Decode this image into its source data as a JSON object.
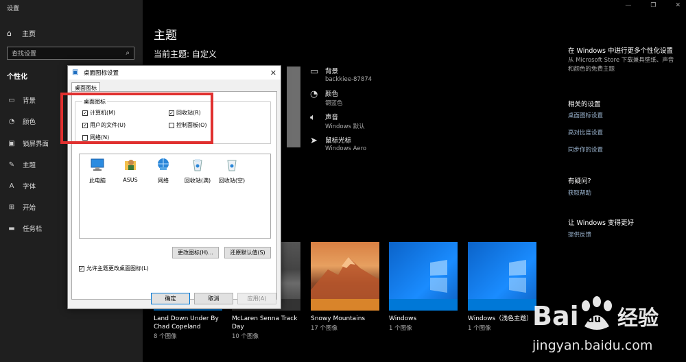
{
  "app": {
    "title": "设置"
  },
  "sidebar": {
    "home": "主页",
    "search_placeholder": "查找设置",
    "section": "个性化",
    "items": [
      {
        "label": "背景",
        "icon": "image-icon"
      },
      {
        "label": "颜色",
        "icon": "palette-icon"
      },
      {
        "label": "锁屏界面",
        "icon": "lockscreen-icon"
      },
      {
        "label": "主题",
        "icon": "brush-icon"
      },
      {
        "label": "字体",
        "icon": "font-icon"
      },
      {
        "label": "开始",
        "icon": "start-icon"
      },
      {
        "label": "任务栏",
        "icon": "taskbar-icon"
      }
    ]
  },
  "main": {
    "title": "主题",
    "current_theme": "当前主题: 自定义",
    "props": [
      {
        "title": "背景",
        "sub": "backkiee-87874",
        "icon": "image-icon"
      },
      {
        "title": "颜色",
        "sub": "钢蓝色",
        "icon": "palette-icon"
      },
      {
        "title": "声音",
        "sub": "Windows 默认",
        "icon": "speaker-icon"
      },
      {
        "title": "鼠标光标",
        "sub": "Windows Aero",
        "icon": "cursor-icon"
      }
    ],
    "themes": [
      {
        "name": "Land Down Under By Chad Copeland",
        "count": "8 个图像",
        "bar_color": "#1e2a4a"
      },
      {
        "name": "McLaren Senna Track Day",
        "count": "10 个图像",
        "bar_color": "#333333"
      },
      {
        "name": "Snowy Mountains",
        "count": "17 个图像",
        "bar_color": "#d9842a"
      },
      {
        "name": "Windows",
        "count": "1 个图像",
        "bar_color": "#0078d7"
      },
      {
        "name": "Windows（浅色主题）",
        "count": "1 个图像",
        "bar_color": "#0078d7"
      }
    ]
  },
  "right": {
    "more_title": "在 Windows 中进行更多个性化设置",
    "more_desc": "从 Microsoft Store 下载兼具壁纸、声音和颜色的免费主题",
    "related_title": "相关的设置",
    "related_links": [
      "桌面图标设置",
      "高对比度设置",
      "同步你的设置"
    ],
    "help_title": "有疑问?",
    "help_link": "获取帮助",
    "improve_title": "让 Windows 变得更好",
    "improve_link": "提供反馈"
  },
  "dialog": {
    "title": "桌面图标设置",
    "tab": "桌面图标",
    "group_label": "桌面图标",
    "checkboxes": [
      {
        "label": "计算机(M)",
        "checked": true
      },
      {
        "label": "回收站(R)",
        "checked": true
      },
      {
        "label": "用户的文件(U)",
        "checked": true
      },
      {
        "label": "控制面板(O)",
        "checked": false
      },
      {
        "label": "网络(N)",
        "checked": false
      }
    ],
    "icons": [
      "此电脑",
      "ASUS",
      "网络",
      "回收站(满)",
      "回收站(空)"
    ],
    "change_icon": "更改图标(H)...",
    "restore_default": "还原默认值(S)",
    "allow_themes": "允许主题更改桌面图标(L)",
    "ok": "确定",
    "cancel": "取消",
    "apply": "应用(A)"
  },
  "watermark": {
    "brand": "Bai",
    "brand2": "du",
    "suffix": "经验",
    "url": "jingyan.baidu.com"
  },
  "colors": {
    "accent": "#0078d7",
    "annotation": "#e0302f",
    "link": "#9ab3ce"
  }
}
